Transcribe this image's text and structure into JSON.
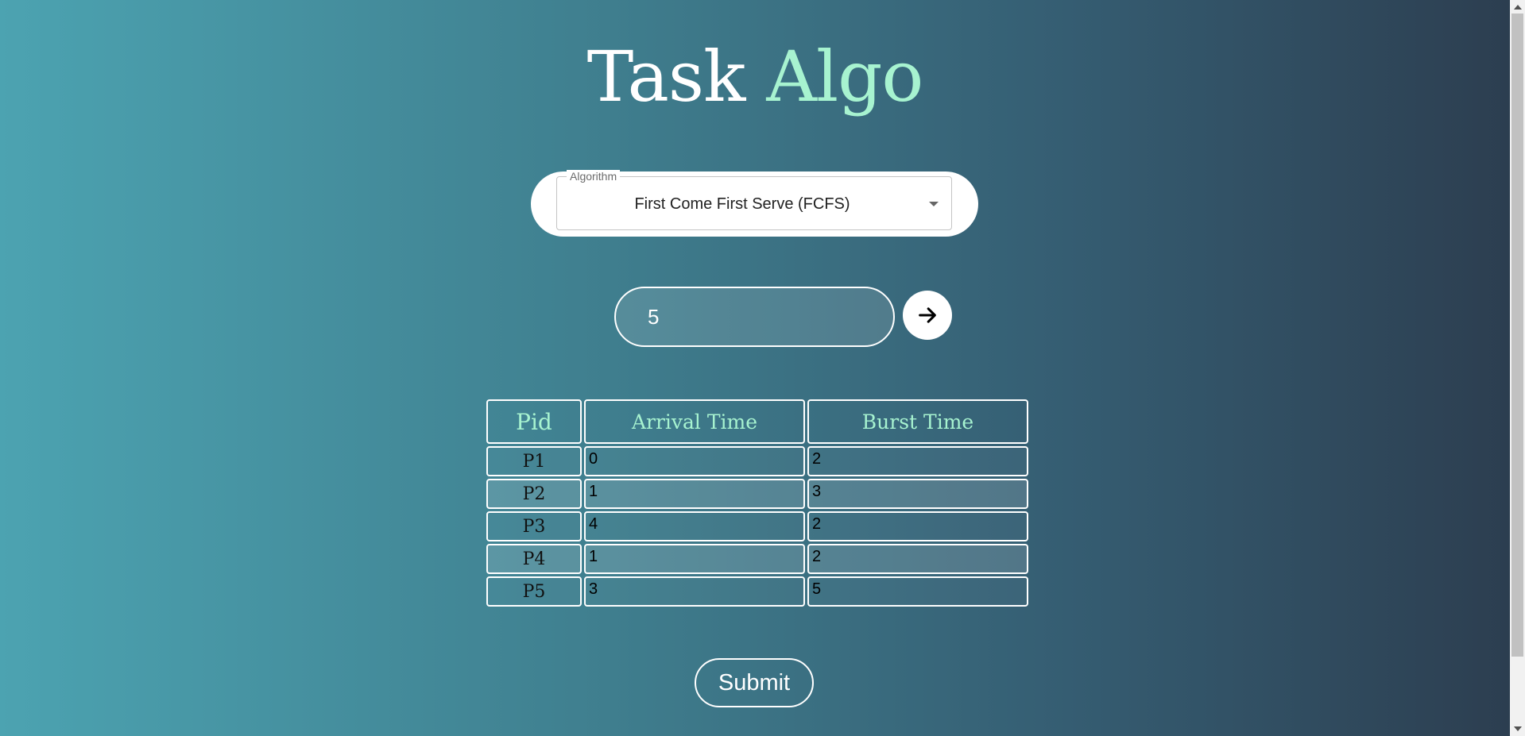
{
  "header": {
    "title_main": "Task",
    "title_accent": "Algo"
  },
  "algorithm_select": {
    "legend": "Algorithm",
    "selected": "First Come First Serve (FCFS)"
  },
  "process_count": {
    "value": "5"
  },
  "table": {
    "headers": [
      "Pid",
      "Arrival Time",
      "Burst Time"
    ],
    "rows": [
      {
        "pid": "P1",
        "arrival": "0",
        "burst": "2"
      },
      {
        "pid": "P2",
        "arrival": "1",
        "burst": "3"
      },
      {
        "pid": "P3",
        "arrival": "4",
        "burst": "2"
      },
      {
        "pid": "P4",
        "arrival": "1",
        "burst": "2"
      },
      {
        "pid": "P5",
        "arrival": "3",
        "burst": "5"
      }
    ]
  },
  "actions": {
    "submit_label": "Submit"
  },
  "icons": {
    "go_button": "arrow-right-icon",
    "select_caret": "caret-down-icon"
  },
  "colors": {
    "accent": "#a7f3d0",
    "gradient_start": "#4ca3b1",
    "gradient_end": "#2c3d4f"
  }
}
